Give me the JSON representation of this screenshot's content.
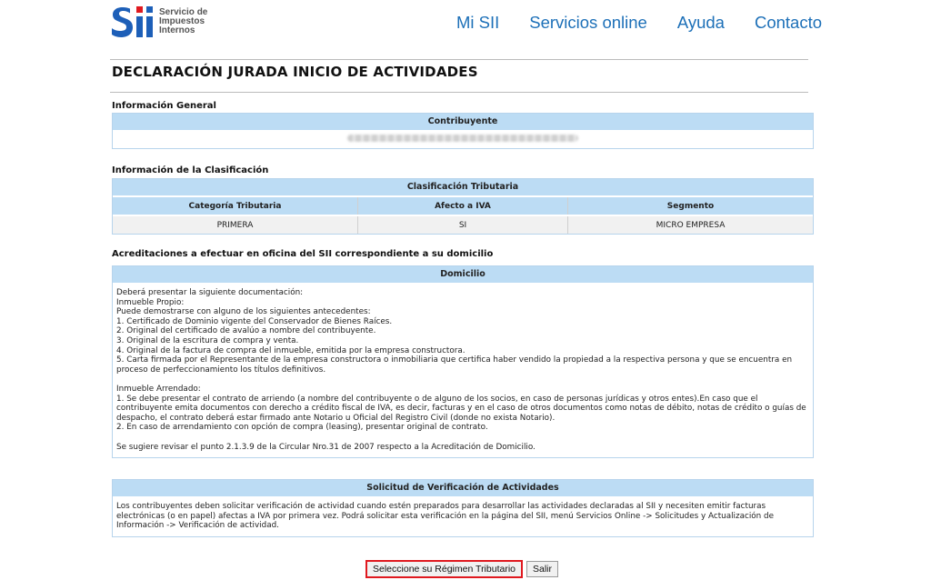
{
  "header": {
    "logo_lines": [
      "Servicio de",
      "Impuestos",
      "Internos"
    ],
    "nav": [
      "Mi SII",
      "Servicios online",
      "Ayuda",
      "Contacto"
    ]
  },
  "page_title": "DECLARACIÓN JURADA INICIO DE ACTIVIDADES",
  "general": {
    "heading": "Información General",
    "box_title": "Contribuyente"
  },
  "clasificacion": {
    "heading": "Información de la Clasificación",
    "box_title": "Clasificación Tributaria",
    "columns": [
      "Categoría Tributaria",
      "Afecto a IVA",
      "Segmento"
    ],
    "values": [
      "PRIMERA",
      "SI",
      "MICRO EMPRESA"
    ]
  },
  "acreditaciones": {
    "heading": "Acreditaciones a efectuar en oficina del SII correspondiente a su domicilio",
    "box_title": "Domicilio",
    "lines": [
      "Deberá presentar la siguiente documentación:",
      "Inmueble Propio:",
      "Puede demostrarse con alguno de los siguientes antecedentes:",
      "1. Certificado de Dominio vigente del Conservador de Bienes Raíces.",
      "2. Original del certificado de avalúo a nombre del contribuyente.",
      "3. Original de la escritura de compra y venta.",
      "4. Original de la factura de compra del inmueble, emitida por la empresa constructora.",
      "5. Carta firmada por el Representante de la empresa constructora o inmobiliaria que certifica haber vendido la propiedad a la respectiva persona y que se encuentra en proceso de perfeccionamiento los títulos definitivos.",
      "",
      "Inmueble Arrendado:",
      "1. Se debe presentar el contrato de arriendo (a nombre del contribuyente o de alguno de los socios, en caso de personas jurídicas y otros entes).En caso que el contribuyente emita documentos con derecho a crédito fiscal de IVA, es decir, facturas y en el caso de otros documentos como notas de débito, notas de crédito o guías de despacho, el contrato deberá estar firmado ante Notario u Oficial del Registro Civil (donde no exista Notario).",
      "2. En caso de arrendamiento con opción de compra (leasing), presentar original de contrato.",
      "",
      "Se sugiere revisar el punto 2.1.3.9 de la Circular Nro.31 de 2007 respecto a la Acreditación de Domicilio."
    ]
  },
  "verificacion": {
    "box_title": "Solicitud de Verificación de Actividades",
    "text": "Los contribuyentes deben solicitar verificación de actividad cuando estén preparados para desarrollar las actividades declaradas al SII y necesiten emitir facturas electrónicas (o en papel) afectas a IVA por primera vez. Podrá solicitar esta verificación en la página del SII, menú Servicios Online -> Solicitudes y Actualización de Información -> Verificación de actividad."
  },
  "buttons": {
    "primary": "Seleccione su Régimen Tributario",
    "secondary": "Salir"
  },
  "colors": {
    "nav_link": "#1d70b8",
    "box_header": "#bcdcf4",
    "highlight_border": "#e0191f",
    "logo_blue": "#1d5fb8"
  }
}
